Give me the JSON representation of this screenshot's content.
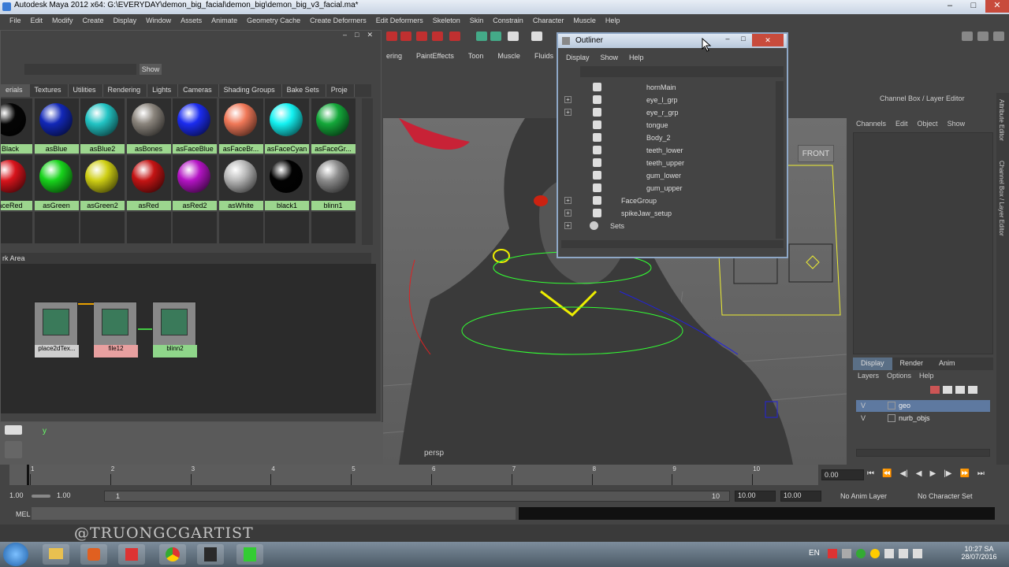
{
  "window": {
    "title": "Autodesk Maya 2012 x64: G:\\EVERYDAY\\demon_big_facial\\demon_big\\demon_big_v3_facial.ma*"
  },
  "menubar": [
    "File",
    "Edit",
    "Modify",
    "Create",
    "Display",
    "Window",
    "Assets",
    "Animate",
    "Geometry Cache",
    "Create Deformers",
    "Edit Deformers",
    "Skeleton",
    "Skin",
    "Constrain",
    "Character",
    "Muscle",
    "Help"
  ],
  "shelf_tabs": [
    "ering",
    "PaintEffects",
    "Toon",
    "Muscle",
    "Fluids"
  ],
  "hypershade": {
    "show_label": "Show",
    "tabs": [
      "erials",
      "Textures",
      "Utilities",
      "Rendering",
      "Lights",
      "Cameras",
      "Shading Groups",
      "Bake Sets",
      "Proje"
    ],
    "row1": [
      {
        "label": "Black",
        "color": "#050505"
      },
      {
        "label": "asBlue",
        "color": "#1228b8"
      },
      {
        "label": "asBlue2",
        "color": "#22c4c4"
      },
      {
        "label": "asBones",
        "color": "#8a847c"
      },
      {
        "label": "asFaceBlue",
        "color": "#1b2cf0"
      },
      {
        "label": "asFaceBr...",
        "color": "#f07858"
      },
      {
        "label": "asFaceCyan",
        "color": "#14f2f2"
      },
      {
        "label": "asFaceGr...",
        "color": "#14a83a"
      }
    ],
    "row2": [
      {
        "label": "aceRed",
        "color": "#d8141c"
      },
      {
        "label": "asGreen",
        "color": "#18d41c"
      },
      {
        "label": "asGreen2",
        "color": "#cfcf14"
      },
      {
        "label": "asRed",
        "color": "#c41414"
      },
      {
        "label": "asRed2",
        "color": "#b414c4"
      },
      {
        "label": "asWhite",
        "color": "#b8b8b8"
      },
      {
        "label": "black1",
        "color": "#020202"
      },
      {
        "label": "blinn1",
        "color": "#8c8c8c"
      }
    ],
    "work_area_label": "rk Area",
    "nodes": [
      {
        "label": "place2dTex...",
        "color": "#cfcfcf"
      },
      {
        "label": "file12",
        "color": "#e8a0a0"
      },
      {
        "label": "blinn2",
        "color": "#8fd68a"
      }
    ]
  },
  "outliner": {
    "title": "Outliner",
    "menu": [
      "Display",
      "Show",
      "Help"
    ],
    "rows": [
      {
        "label": "hornMain",
        "expand": false
      },
      {
        "label": "eye_l_grp",
        "expand": true
      },
      {
        "label": "eye_r_grp",
        "expand": true
      },
      {
        "label": "tongue",
        "expand": false
      },
      {
        "label": "Body_2",
        "expand": false
      },
      {
        "label": "teeth_lower",
        "expand": false
      },
      {
        "label": "teeth_upper",
        "expand": false
      },
      {
        "label": "gum_lower",
        "expand": false
      },
      {
        "label": "gum_upper",
        "expand": false
      },
      {
        "label": "FaceGroup",
        "expand": true
      },
      {
        "label": "spikeJaw_setup",
        "expand": true
      },
      {
        "label": "Sets",
        "expand": true
      }
    ]
  },
  "viewport": {
    "camera_label": "persp",
    "front_label": "FRONT",
    "axis_y": "y"
  },
  "channel_box": {
    "header": "Channel Box / Layer Editor",
    "menu": [
      "Channels",
      "Edit",
      "Object",
      "Show"
    ],
    "side_tab1": "Attribute Editor",
    "side_tab2": "Channel Box / Layer Editor",
    "layer_tabs": [
      "Display",
      "Render",
      "Anim"
    ],
    "layer_menu": [
      "Layers",
      "Options",
      "Help"
    ],
    "layers": [
      {
        "v": "V",
        "name": "geo",
        "selected": true
      },
      {
        "v": "V",
        "name": "nurb_objs",
        "selected": false
      }
    ]
  },
  "timeline": {
    "ticks": [
      "1",
      "2",
      "3",
      "4",
      "5",
      "6",
      "7",
      "8",
      "9",
      "10"
    ],
    "current_time": "0.00"
  },
  "range": {
    "start": "1.00",
    "start2": "1.00",
    "slider_start": "1",
    "slider_end": "10",
    "end": "10.00",
    "end2": "10.00",
    "anim_layer": "No Anim Layer",
    "char_set": "No Character Set"
  },
  "cmd": {
    "label": "MEL"
  },
  "watermark": "@TRUONGCGARTIST",
  "taskbar": {
    "lang": "EN",
    "time": "10:27 SA",
    "date": "28/07/2016"
  }
}
